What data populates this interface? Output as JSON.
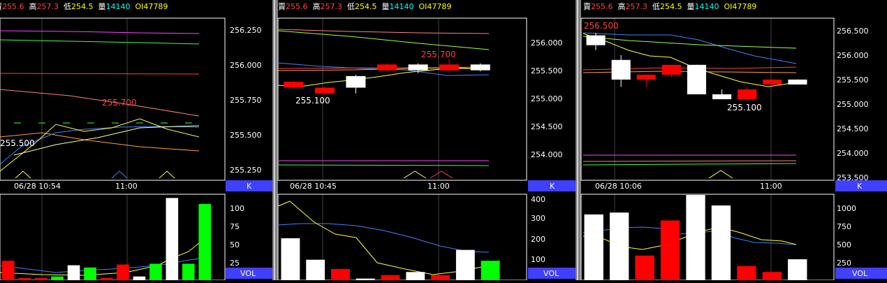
{
  "colors": {
    "background": "#000000",
    "grid_line": "#ffffff",
    "divider": "#c0c0c0",
    "up_candle": "#ffffff",
    "down_candle": "#ff0000",
    "green_bar": "#00ff00",
    "button_bg": "#4040ff",
    "header_label": "#ffffff",
    "sell_value": "#ff4040",
    "high_value": "#ff4040",
    "low_value": "#ffff00",
    "vol_value": "#00ffff",
    "oi_value": "#ffff00"
  },
  "header": {
    "sell_label": "賣",
    "sell_value": "255.6",
    "high_label": "高",
    "high_value": "257.3",
    "low_label": "低",
    "low_value": "254.5",
    "vol_label": "量",
    "vol_value": "14140",
    "oi_label": "OI",
    "oi_value": "47789"
  },
  "panels": [
    {
      "id": "p1",
      "price_ticks": [
        "256.250",
        "256.000",
        "255.750",
        "255.500",
        "255.250"
      ],
      "price_lim": [
        255.2,
        256.3
      ],
      "time_labels": [
        "06/28 10:54",
        "11:00"
      ],
      "k_button": "K",
      "vol_button": "VOL",
      "vol_ticks": [
        "100",
        "75",
        "50",
        "25"
      ],
      "vol_lim": [
        0,
        115
      ],
      "annotations": [
        {
          "text": "255.700",
          "color": "#ff4040"
        },
        {
          "text": "255.500",
          "color": "#ffffff"
        }
      ],
      "candles": [],
      "volumes": [
        {
          "v": 26,
          "c": "red"
        },
        {
          "v": 3,
          "c": "red"
        },
        {
          "v": 3,
          "c": "red"
        },
        {
          "v": 5,
          "c": "green"
        },
        {
          "v": 20,
          "c": "white"
        },
        {
          "v": 17,
          "c": "green"
        },
        {
          "v": 3,
          "c": "red"
        },
        {
          "v": 21,
          "c": "red"
        },
        {
          "v": 5,
          "c": "white"
        },
        {
          "v": 22,
          "c": "green"
        },
        {
          "v": 110,
          "c": "white"
        },
        {
          "v": 22,
          "c": "green"
        },
        {
          "v": 102,
          "c": "green"
        }
      ]
    },
    {
      "id": "p2",
      "price_ticks": [
        "256.000",
        "255.500",
        "255.000",
        "254.500",
        "254.000"
      ],
      "price_lim": [
        253.6,
        256.4
      ],
      "time_labels": [
        "06/28 10:45",
        "11:00"
      ],
      "k_button": "K",
      "vol_button": "VOL",
      "vol_ticks": [
        "400",
        "300",
        "200",
        "100"
      ],
      "vol_lim": [
        0,
        420
      ],
      "annotations": [
        {
          "text": "255.700",
          "color": "#ff4040"
        },
        {
          "text": "255.100",
          "color": "#ffffff"
        }
      ],
      "candles": [
        {
          "o": 255.3,
          "c": 255.2,
          "h": 255.32,
          "l": 255.18
        },
        {
          "o": 255.2,
          "c": 255.1,
          "h": 255.22,
          "l": 255.08
        },
        {
          "o": 255.2,
          "c": 255.4,
          "h": 255.42,
          "l": 255.1
        },
        {
          "o": 255.6,
          "c": 255.5,
          "h": 255.62,
          "l": 255.48
        },
        {
          "o": 255.5,
          "c": 255.6,
          "h": 255.62,
          "l": 255.45
        },
        {
          "o": 255.6,
          "c": 255.5,
          "h": 255.7,
          "l": 255.48
        },
        {
          "o": 255.5,
          "c": 255.6,
          "h": 255.62,
          "l": 255.48
        }
      ],
      "volumes": [
        {
          "v": 205,
          "c": "white"
        },
        {
          "v": 100,
          "c": "white"
        },
        {
          "v": 55,
          "c": "red"
        },
        {
          "v": 8,
          "c": "white"
        },
        {
          "v": 25,
          "c": "red"
        },
        {
          "v": 40,
          "c": "white"
        },
        {
          "v": 25,
          "c": "red"
        },
        {
          "v": 148,
          "c": "white"
        },
        {
          "v": 95,
          "c": "green"
        }
      ]
    },
    {
      "id": "p3",
      "price_ticks": [
        "256.500",
        "256.000",
        "255.500",
        "255.000",
        "254.500",
        "254.000",
        "253.500"
      ],
      "price_lim": [
        253.45,
        256.75
      ],
      "time_labels": [
        "06/28 10:06",
        "11:00"
      ],
      "k_button": "K",
      "vol_button": "VOL",
      "vol_ticks": [
        "1000",
        "750",
        "500",
        "250"
      ],
      "vol_lim": [
        0,
        1150
      ],
      "annotations": [
        {
          "text": "256.500",
          "color": "#ff4040"
        },
        {
          "text": "255.100",
          "color": "#ffffff"
        }
      ],
      "candles": [
        {
          "o": 256.2,
          "c": 256.4,
          "h": 256.45,
          "l": 256.1
        },
        {
          "o": 255.5,
          "c": 255.9,
          "h": 256.0,
          "l": 255.35
        },
        {
          "o": 255.6,
          "c": 255.5,
          "h": 255.6,
          "l": 255.35
        },
        {
          "o": 255.8,
          "c": 255.6,
          "h": 255.8,
          "l": 255.55
        },
        {
          "o": 255.2,
          "c": 255.8,
          "h": 255.8,
          "l": 255.2
        },
        {
          "o": 255.1,
          "c": 255.2,
          "h": 255.3,
          "l": 255.1
        },
        {
          "o": 255.3,
          "c": 255.1,
          "h": 255.35,
          "l": 255.1
        },
        {
          "o": 255.5,
          "c": 255.4,
          "h": 255.5,
          "l": 255.4
        },
        {
          "o": 255.4,
          "c": 255.5,
          "h": 255.5,
          "l": 255.4
        }
      ],
      "volumes": [
        {
          "v": 880,
          "c": "white"
        },
        {
          "v": 905,
          "c": "white"
        },
        {
          "v": 330,
          "c": "red"
        },
        {
          "v": 800,
          "c": "red"
        },
        {
          "v": 1140,
          "c": "white"
        },
        {
          "v": 1000,
          "c": "white"
        },
        {
          "v": 190,
          "c": "red"
        },
        {
          "v": 110,
          "c": "red"
        },
        {
          "v": 280,
          "c": "white"
        }
      ]
    }
  ]
}
